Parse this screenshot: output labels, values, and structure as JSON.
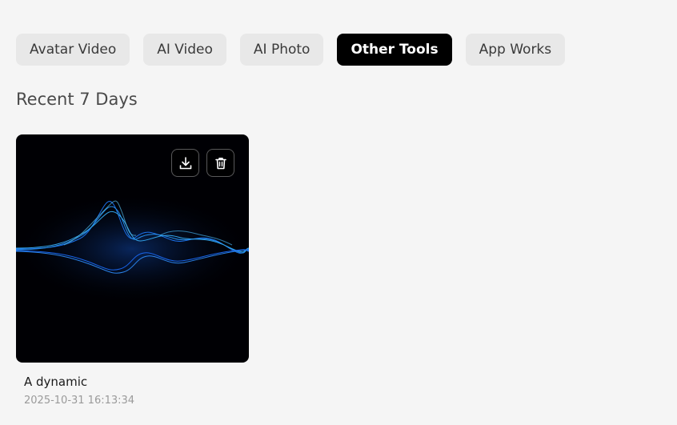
{
  "tabs": [
    {
      "label": "Avatar Video",
      "active": false
    },
    {
      "label": "AI Video",
      "active": false
    },
    {
      "label": "AI Photo",
      "active": false
    },
    {
      "label": "Other Tools",
      "active": true
    },
    {
      "label": "App Works",
      "active": false
    }
  ],
  "section": {
    "title": "Recent 7 Days"
  },
  "cards": [
    {
      "title": "A dynamic",
      "timestamp": "2025-10-31 16:13:34",
      "actions": {
        "download_icon": "download-icon",
        "delete_icon": "trash-icon"
      }
    }
  ],
  "colors": {
    "background": "#f5f5f5",
    "tab_bg": "#e8e8e8",
    "tab_active_bg": "#000000",
    "wave": "#1e90ff"
  }
}
